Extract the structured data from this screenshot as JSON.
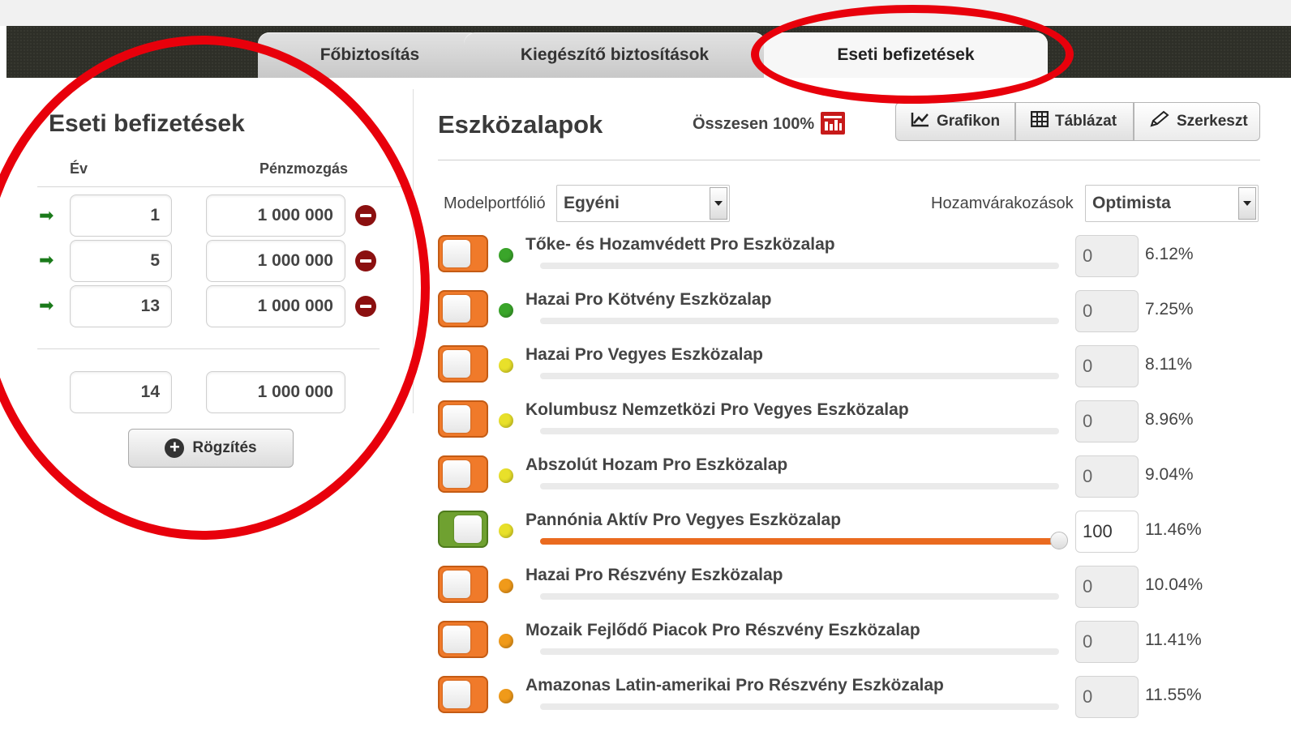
{
  "tabs": [
    {
      "label": "Főbiztosítás"
    },
    {
      "label": "Kiegészítő biztosítások"
    },
    {
      "label": "Eseti befizetések"
    }
  ],
  "left": {
    "title": "Eseti befizetések",
    "col_year": "Év",
    "col_cash": "Pénzmozgás",
    "rows": [
      {
        "year": "1",
        "amount": "1 000 000"
      },
      {
        "year": "5",
        "amount": "1 000 000"
      },
      {
        "year": "13",
        "amount": "1 000 000"
      }
    ],
    "new_row": {
      "year": "14",
      "amount": "1 000 000"
    },
    "save_label": "Rögzítés"
  },
  "right": {
    "title": "Eszközalapok",
    "total": "Összesen 100%",
    "buttons": {
      "chart": "Grafikon",
      "table": "Táblázat",
      "edit": "Szerkeszt"
    },
    "model_label": "Modelportfólió",
    "model_value": "Egyéni",
    "yield_label": "Hozamvárakozások",
    "yield_value": "Optimista"
  },
  "funds": [
    {
      "name": "Tőke- és Hozamvédett Pro Eszközalap",
      "value": "0",
      "pct": "6.12%",
      "risk_color": "#3aa52a",
      "on": false,
      "share": 0
    },
    {
      "name": "Hazai Pro Kötvény Eszközalap",
      "value": "0",
      "pct": "7.25%",
      "risk_color": "#3aa52a",
      "on": false,
      "share": 0
    },
    {
      "name": "Hazai Pro Vegyes Eszközalap",
      "value": "0",
      "pct": "8.11%",
      "risk_color": "#e8e02a",
      "on": false,
      "share": 0
    },
    {
      "name": "Kolumbusz Nemzetközi Pro Vegyes Eszközalap",
      "value": "0",
      "pct": "8.96%",
      "risk_color": "#e8e02a",
      "on": false,
      "share": 0
    },
    {
      "name": "Abszolút Hozam Pro Eszközalap",
      "value": "0",
      "pct": "9.04%",
      "risk_color": "#e8e02a",
      "on": false,
      "share": 0
    },
    {
      "name": "Pannónia Aktív Pro Vegyes Eszközalap",
      "value": "100",
      "pct": "11.46%",
      "risk_color": "#e8e02a",
      "on": true,
      "share": 100
    },
    {
      "name": "Hazai Pro Részvény Eszközalap",
      "value": "0",
      "pct": "10.04%",
      "risk_color": "#f09a1a",
      "on": false,
      "share": 0
    },
    {
      "name": "Mozaik Fejlődő Piacok Pro Részvény Eszközalap",
      "value": "0",
      "pct": "11.41%",
      "risk_color": "#f09a1a",
      "on": false,
      "share": 0
    },
    {
      "name": "Amazonas Latin-amerikai Pro Részvény Eszközalap",
      "value": "0",
      "pct": "11.55%",
      "risk_color": "#f09a1a",
      "on": false,
      "share": 0
    }
  ],
  "colors": {
    "annotation_red": "#e8000b",
    "accent_orange": "#ea6a1f",
    "toggle_green": "#6fa130"
  },
  "icons": {
    "row_arrow": "arrow-right-icon",
    "remove": "minus-circle-icon",
    "add": "plus-circle-icon",
    "total": "bar-chart-icon",
    "chart": "line-chart-icon",
    "table": "grid-icon",
    "edit": "pencil-icon"
  }
}
